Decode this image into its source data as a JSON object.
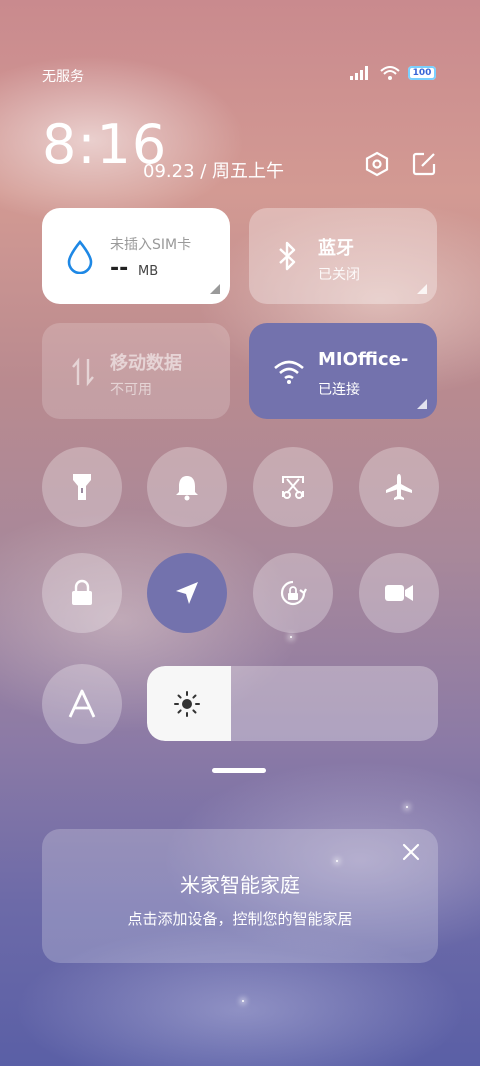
{
  "status_bar": {
    "carrier": "无服务",
    "battery": "100",
    "icons": [
      "signal-icon",
      "wifi-icon",
      "battery-icon"
    ]
  },
  "header": {
    "time": "8:16",
    "date": "09.23 / 周五上午",
    "icons": [
      "settings-hexagon-icon",
      "edit-icon"
    ]
  },
  "tiles": {
    "sim": {
      "title": "未插入SIM卡",
      "value": "--",
      "unit": "MB",
      "icon": "water-drop-icon"
    },
    "bluetooth": {
      "title": "蓝牙",
      "status": "已关闭",
      "icon": "bluetooth-icon"
    },
    "mobile_data": {
      "title": "移动数据",
      "status": "不可用",
      "icon": "mobile-data-icon"
    },
    "wifi": {
      "title": "MIOffice-",
      "status": "已连接",
      "icon": "wifi-icon"
    }
  },
  "toggles": [
    {
      "name": "flashlight",
      "icon": "flashlight-icon",
      "active": false
    },
    {
      "name": "ring",
      "icon": "bell-icon",
      "active": false
    },
    {
      "name": "screenshot",
      "icon": "scissors-icon",
      "active": false
    },
    {
      "name": "airplane",
      "icon": "airplane-icon",
      "active": false
    },
    {
      "name": "lock-screen",
      "icon": "lock-icon",
      "active": false
    },
    {
      "name": "location",
      "icon": "location-arrow-icon",
      "active": true
    },
    {
      "name": "rotation-lock",
      "icon": "rotation-lock-icon",
      "active": false
    },
    {
      "name": "screen-record",
      "icon": "video-camera-icon",
      "active": false
    },
    {
      "name": "font-size",
      "icon": "letter-a-icon",
      "active": false
    }
  ],
  "brightness": {
    "level_fraction": 0.29,
    "icon": "sun-icon"
  },
  "smart_home": {
    "title": "米家智能家庭",
    "subtitle": "点击添加设备，控制您的智能家居",
    "close_icon": "close-icon"
  },
  "colors": {
    "accent": "#7372ad",
    "tile_white": "#ffffff",
    "sim_icon": "#1e88e5"
  }
}
